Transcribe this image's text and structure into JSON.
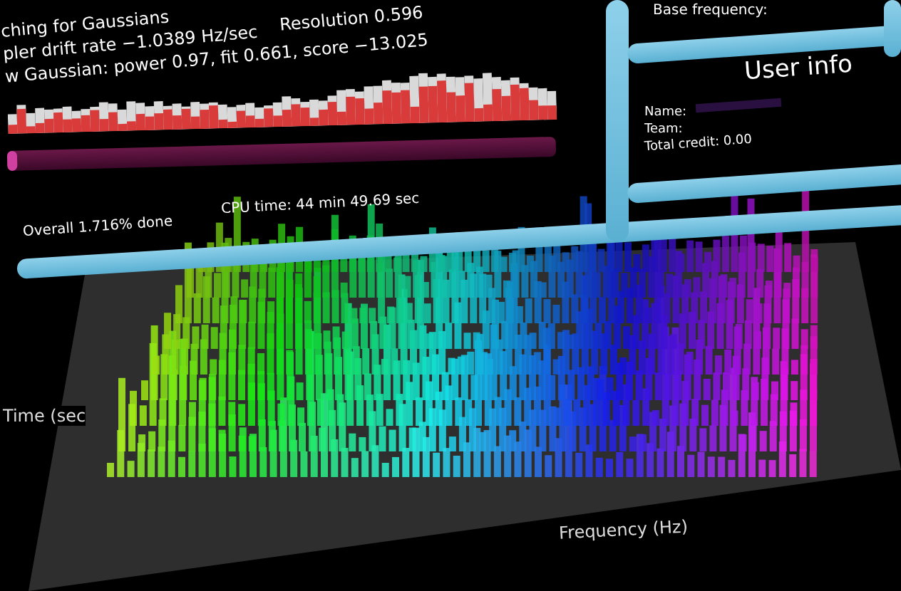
{
  "data_panel": {
    "lines": [
      "ching for Gaussians",
      "pler drift rate −1.0389 Hz/sec",
      "w Gaussian: power  0.97, fit 0.661, score −13.025"
    ],
    "resolution": "Resolution 0.596",
    "overall": "Overall 1.716% done",
    "cpu_time": "CPU time: 44 min 49.69 sec",
    "progress": {
      "level": 0.017
    }
  },
  "base_panel": {
    "label": "Base frequency:"
  },
  "user_info": {
    "title": "User info",
    "name_label": "Name:",
    "team_label": "Team:",
    "credit": "Total credit: 0.00"
  },
  "waterfall": {
    "time_axis": "Time (sec",
    "frequency_axis": "Frequency (Hz)"
  }
}
